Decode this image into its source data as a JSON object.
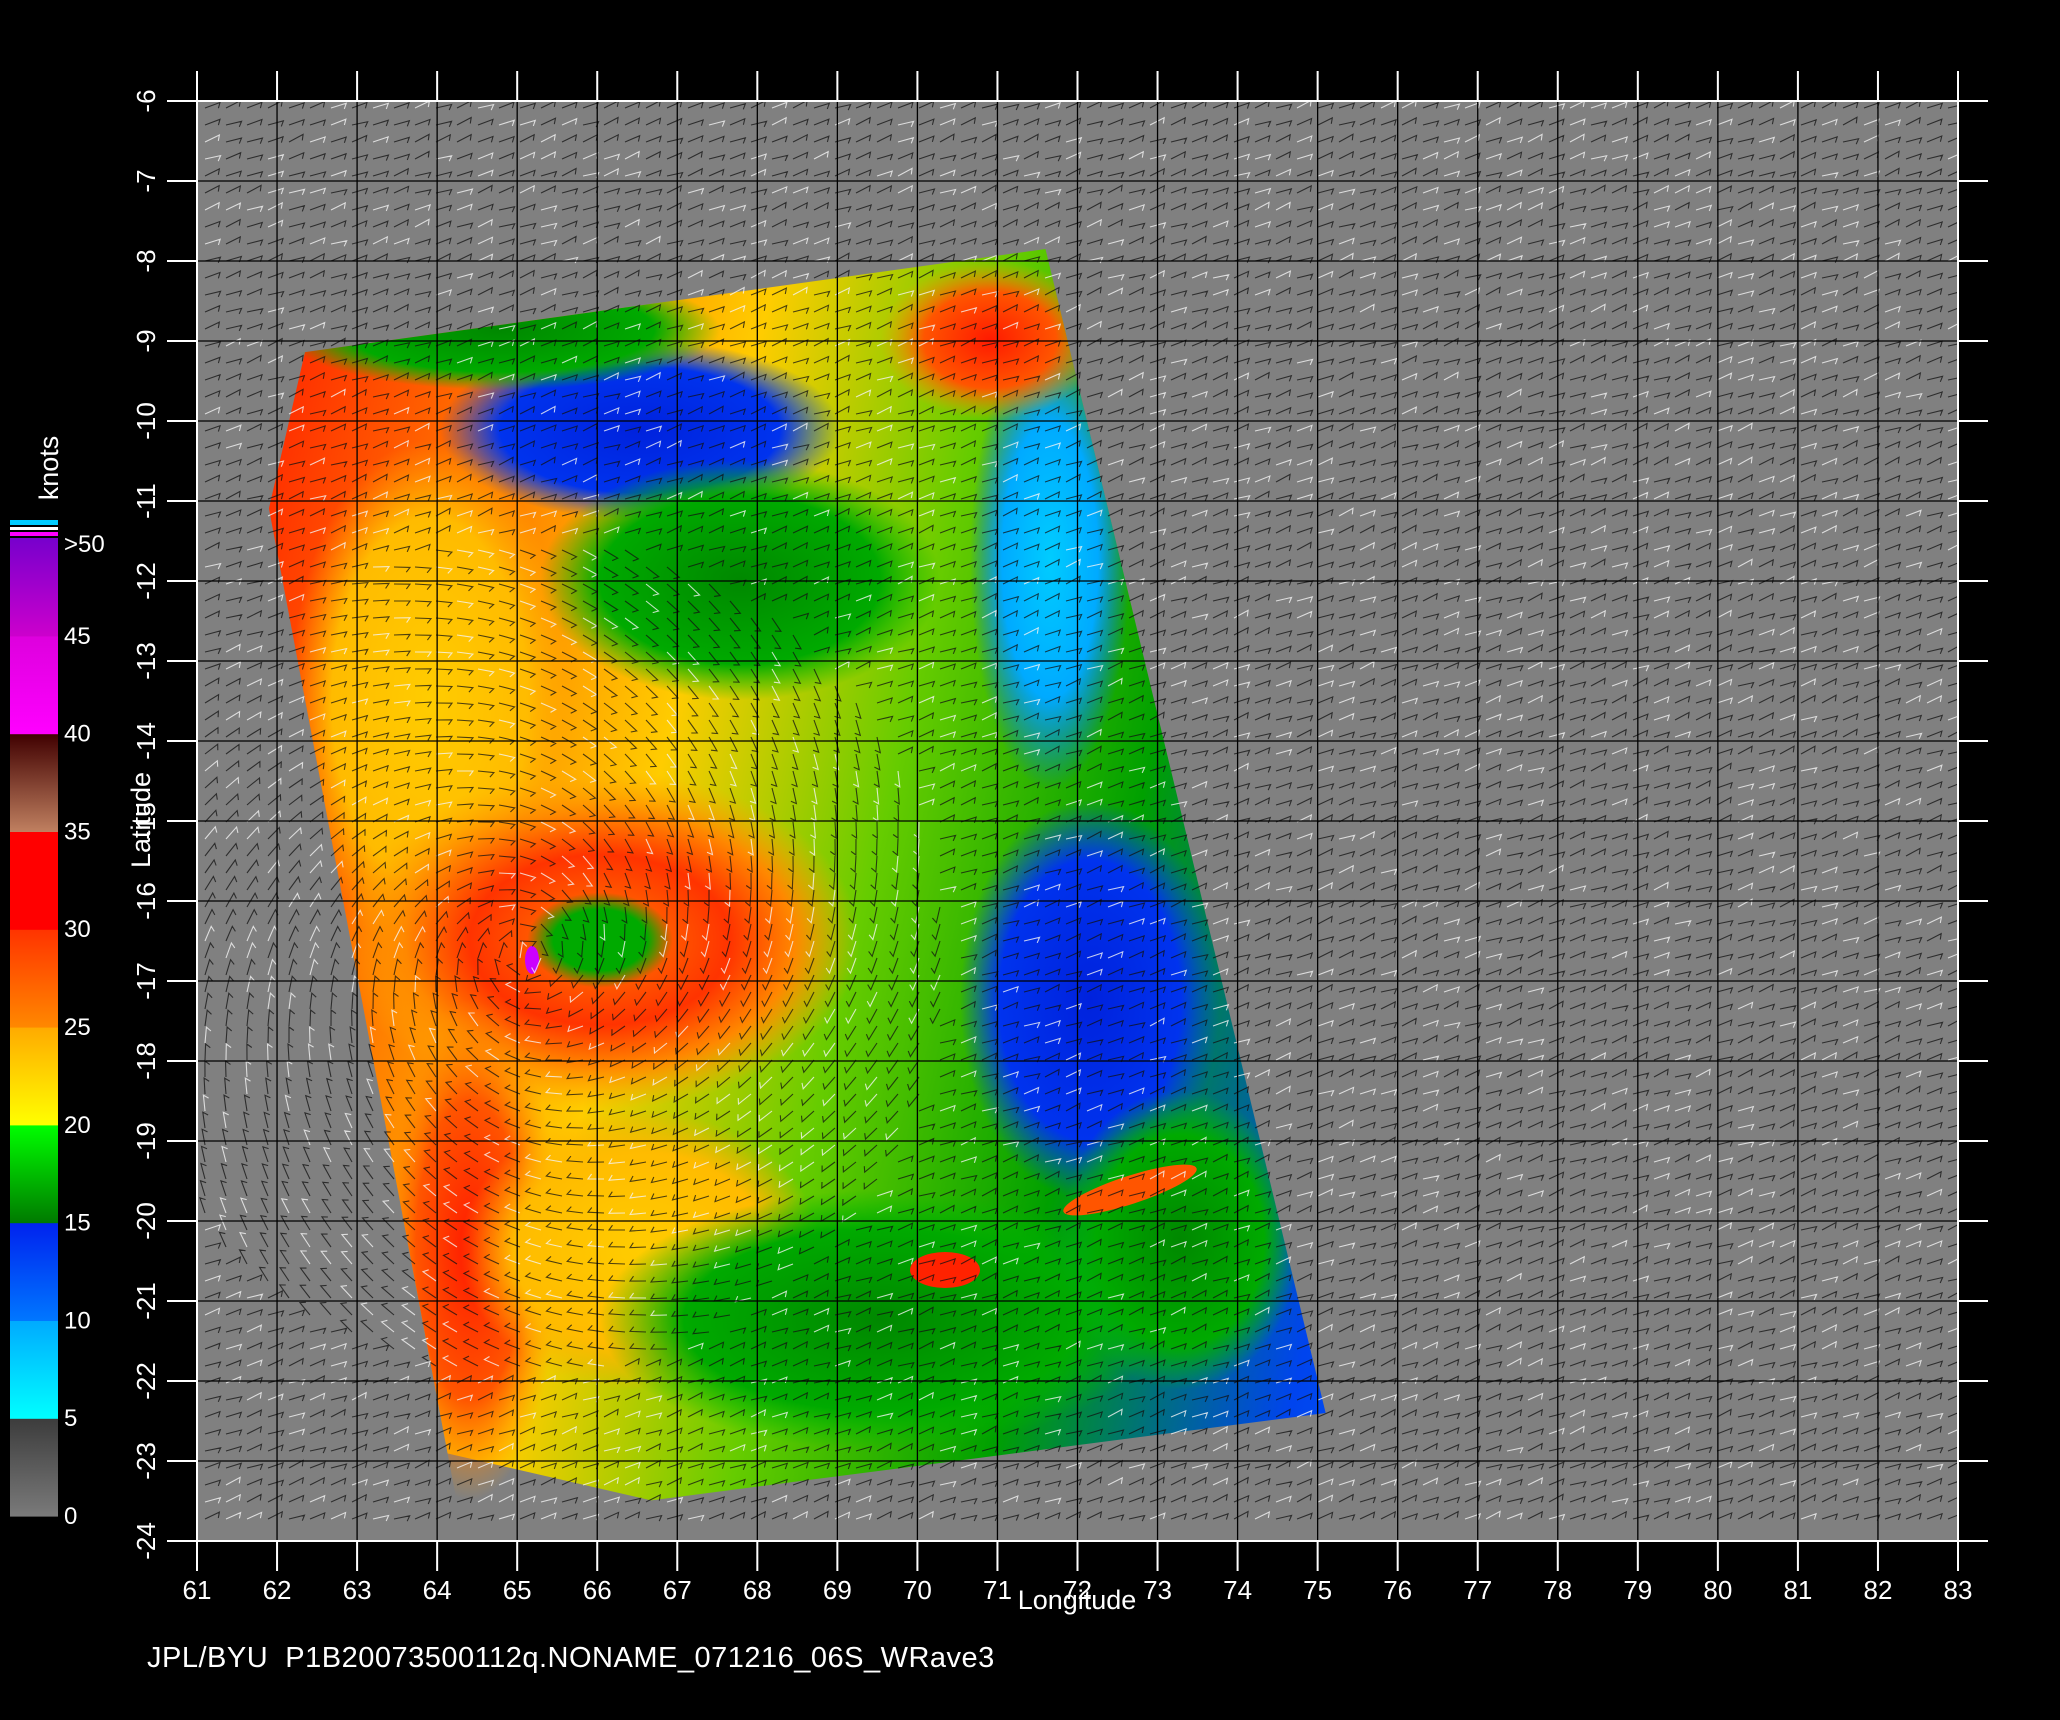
{
  "footer": {
    "credit": "JPL/BYU",
    "filename": "P1B20073500112q.NONAME_071216_06S_WRave3"
  },
  "colorbar": {
    "units": "knots",
    "bands": [
      {
        "from": 0,
        "to": 5,
        "colors": [
          "#7a7a7a",
          "#3c3c3c"
        ]
      },
      {
        "from": 5,
        "to": 10,
        "colors": [
          "#00ffff",
          "#00aaff"
        ]
      },
      {
        "from": 10,
        "to": 15,
        "colors": [
          "#0077ff",
          "#0022ee"
        ]
      },
      {
        "from": 15,
        "to": 20,
        "colors": [
          "#007a00",
          "#00ff00"
        ]
      },
      {
        "from": 20,
        "to": 25,
        "colors": [
          "#ffff00",
          "#ffaa00"
        ]
      },
      {
        "from": 25,
        "to": 30,
        "colors": [
          "#ff8800",
          "#ff3300"
        ]
      },
      {
        "from": 30,
        "to": 35,
        "colors": [
          "#ff0000",
          "#ff0000"
        ]
      },
      {
        "from": 35,
        "to": 40,
        "colors": [
          "#c08060",
          "#400000"
        ]
      },
      {
        "from": 40,
        "to": 45,
        "colors": [
          "#ff00ff",
          "#dd00dd"
        ]
      },
      {
        "from": 45,
        "to": 50,
        "colors": [
          "#cc00cc",
          "#7700cc"
        ]
      }
    ],
    "labels": [
      "0",
      "5",
      "10",
      "15",
      "20",
      "25",
      "30",
      "35",
      "40",
      "45",
      ">50"
    ]
  },
  "map": {
    "xlabel": "Longitude",
    "ylabel": "Latitude",
    "lon_range": [
      61,
      83
    ],
    "lat_range": [
      -24,
      -6
    ],
    "lon_ticks": [
      "61",
      "62",
      "63",
      "64",
      "65",
      "66",
      "67",
      "68",
      "69",
      "70",
      "71",
      "72",
      "73",
      "74",
      "75",
      "76",
      "77",
      "78",
      "79",
      "80",
      "81",
      "82",
      "83"
    ],
    "lat_ticks": [
      "-6",
      "-7",
      "-8",
      "-9",
      "-10",
      "-11",
      "-12",
      "-13",
      "-14",
      "-15",
      "-16",
      "-17",
      "-18",
      "-19",
      "-20",
      "-21",
      "-22",
      "-23",
      "-24"
    ],
    "background_color": "#808080",
    "swath_corners_lonlat": [
      [
        61.55,
        -9.25
      ],
      [
        71.6,
        -7.85
      ],
      [
        75.1,
        -22.4
      ],
      [
        64.3,
        -23.8
      ]
    ],
    "storm_center_lonlat": [
      65.1,
      -16.7
    ]
  }
}
